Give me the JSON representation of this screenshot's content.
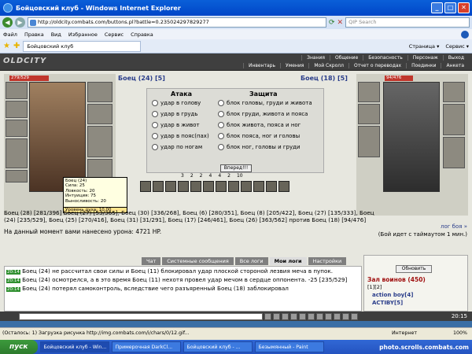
{
  "window": {
    "title": "Бойцовский клуб - Windows Internet Explorer"
  },
  "address": {
    "url": "http://oldcity.combats.com/buttons.pl?battle=0.235024297829277",
    "search_placeholder": "QIP Search"
  },
  "menu": [
    "Файл",
    "Правка",
    "Вид",
    "Избранное",
    "Сервис",
    "Справка"
  ],
  "tab": {
    "label": "Бойцовский клуб",
    "tools": [
      "Страница ▾",
      "Сервис ▾"
    ]
  },
  "game": {
    "logo": "OLDCITY",
    "menu_top": [
      "Знания",
      "Общение",
      "Безопасность",
      "Персонаж",
      "Выход"
    ],
    "menu_bottom": [
      "Инвентарь",
      "Умения",
      "Мой Скролл",
      "Отчет о переводах",
      "Поединки",
      "Анкета"
    ],
    "left_fighter": {
      "name": "Боец (24) [5]",
      "hp": "279/529"
    },
    "right_fighter": {
      "name": "Боец (18) [5]",
      "hp": "94/476"
    },
    "attack": {
      "header": "Атака",
      "options": [
        "удар в голову",
        "удар в грудь",
        "удар в живот",
        "удар в пояс(пах)",
        "удар по ногам"
      ]
    },
    "defense": {
      "header": "Защита",
      "options": [
        "блок головы, груди и живота",
        "блок груди, живота и пояса",
        "блок живота, пояса и ног",
        "блок пояса, ног и головы",
        "блок ног, головы и груди"
      ]
    },
    "go_button": "Вперед!!!",
    "counters": [
      "3",
      "2",
      "2",
      "4",
      "4",
      "2",
      "10"
    ],
    "tooltip": {
      "lines": [
        "Боец (24)",
        "Сила: 25",
        "Ловкость: 20",
        "Интуиция: 75",
        "Выносливость: 20"
      ],
      "footer": "Уровень духа: 10.00"
    },
    "foes_line1": "Боец (28) [281/396] Боец (27) [53/365], Боец (30) [336/268], Боец (6) [280/351], Боец (8) [205/422], Боец (27) [135/333], Боец",
    "foes_line2": "(24) [235/529], Боец (25) [270/416], Боец (31) [31/291], Боец (17) [246/461], Боец (26) [363/562] против Боец (18) [94/476]",
    "foes_line3": "лог боя »",
    "damage_text": "На данный момент вами нанесено урона: 4721 HP.",
    "timeout_text": "(Бой идет с таймаутом 1 мин.)"
  },
  "chat": {
    "tabs": [
      "Чат",
      "Системные сообщения",
      "Все логи",
      "Мои логи",
      "Настройки"
    ],
    "lines": [
      {
        "time": "20:14",
        "text": "Боец (24) не рассчитал свои силы и Боец (11) блокировал удар плоской стороной лезвия меча в пупок."
      },
      {
        "time": "20:14",
        "text": "Боец (24) осмотрелся, а в это время Боец (11) нехотя провел удар мечом в сердце оппонента. -25 [235/529]"
      },
      {
        "time": "20:14",
        "text": "Боец (24) потерял самоконтроль, вследствие чего разъяренный Боец (18) заблокировал"
      }
    ]
  },
  "side": {
    "refresh": "Обновить",
    "room": "Зал воинов (450)",
    "pages": "[1][2]",
    "users": [
      "action boy[4]",
      "ACTIBY[5]"
    ]
  },
  "clock": "20:15",
  "status": {
    "text": "(Осталось: 1) Загрузка рисунка http://img.combats.com/i/chars/0/12.gif...",
    "zone": "Интернет",
    "zoom": "100%"
  },
  "taskbar": {
    "start": "пуск",
    "tasks": [
      "Бойцовский клуб - Win...",
      "Примерочная DarkCl...",
      "Бойцовский клуб - ...",
      "Безымянный - Paint"
    ],
    "tray": "photo.scrolls.combats.com"
  }
}
